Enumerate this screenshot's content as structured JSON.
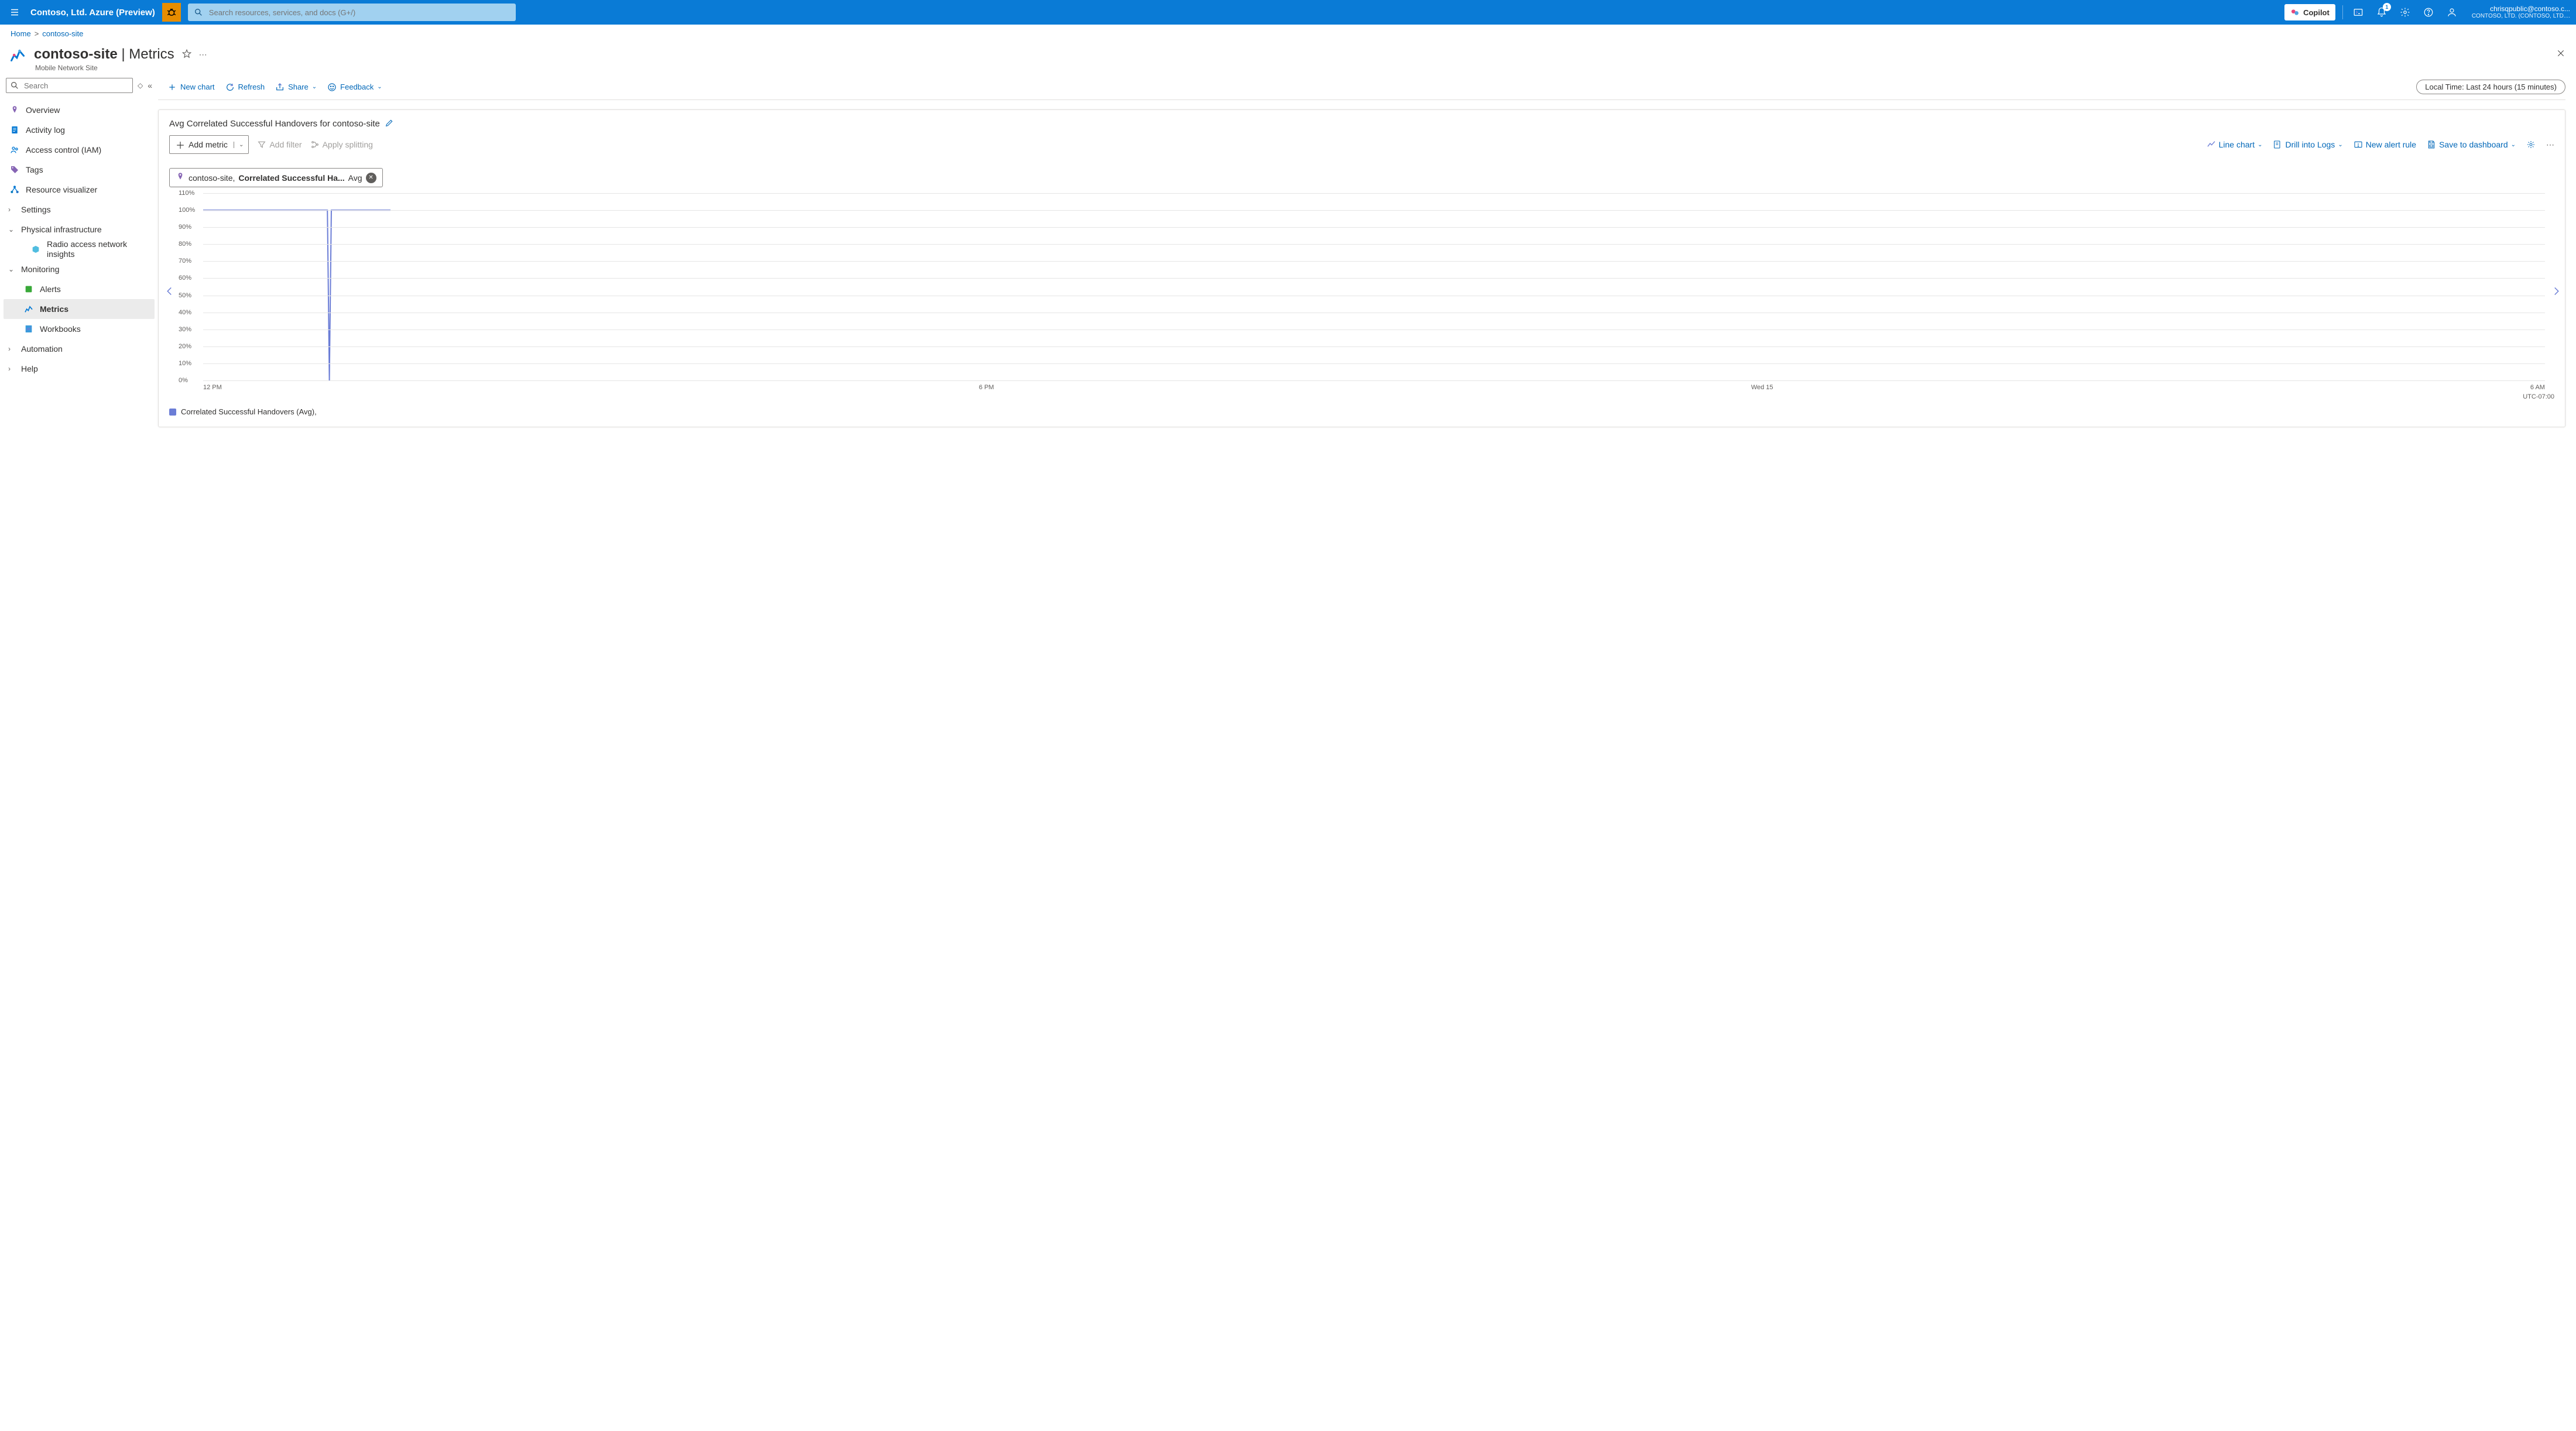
{
  "header": {
    "tenant_title": "Contoso, Ltd. Azure (Preview)",
    "search_placeholder": "Search resources, services, and docs (G+/)",
    "copilot_label": "Copilot",
    "notification_badge": "1",
    "account_email": "chrisqpublic@contoso.c...",
    "account_tenant": "CONTOSO, LTD. (CONTOSO, LTD...."
  },
  "breadcrumbs": {
    "home": "Home",
    "current": "contoso-site"
  },
  "page": {
    "resource_name": "contoso-site",
    "blade_title": "Metrics",
    "subtitle": "Mobile Network Site"
  },
  "sidebar": {
    "search_placeholder": "Search",
    "items": {
      "overview": "Overview",
      "activity": "Activity log",
      "iam": "Access control (IAM)",
      "tags": "Tags",
      "resviz": "Resource visualizer",
      "settings": "Settings",
      "phys_infra": "Physical infrastructure",
      "ran": "Radio access network insights",
      "monitoring": "Monitoring",
      "alerts": "Alerts",
      "metrics": "Metrics",
      "workbooks": "Workbooks",
      "automation": "Automation",
      "help": "Help"
    }
  },
  "commands": {
    "new_chart": "New chart",
    "refresh": "Refresh",
    "share": "Share",
    "feedback": "Feedback",
    "time_range": "Local Time: Last 24 hours (15 minutes)"
  },
  "chart": {
    "title": "Avg Correlated Successful Handovers for contoso-site",
    "add_metric": "Add metric",
    "add_filter": "Add filter",
    "apply_splitting": "Apply splitting",
    "line_chart": "Line chart",
    "drill_logs": "Drill into Logs",
    "new_alert": "New alert rule",
    "save_dash": "Save to dashboard",
    "metric_scope": "contoso-site,",
    "metric_name": "Correlated Successful Ha...",
    "metric_agg": "Avg",
    "legend_label": "Correlated Successful Handovers (Avg),",
    "tz_label": "UTC-07:00"
  },
  "chart_data": {
    "type": "line",
    "title": "Avg Correlated Successful Handovers for contoso-site",
    "xlabel": "",
    "ylabel": "",
    "ylim": [
      0,
      110
    ],
    "y_ticks": [
      110,
      100,
      90,
      80,
      70,
      60,
      50,
      40,
      30,
      20,
      10,
      0
    ],
    "y_tick_labels": [
      "110%",
      "100%",
      "90%",
      "80%",
      "70%",
      "60%",
      "50%",
      "40%",
      "30%",
      "20%",
      "10%",
      "0%"
    ],
    "x_tick_labels": [
      "12 PM",
      "6 PM",
      "Wed 15",
      "6 AM"
    ],
    "series": [
      {
        "name": "Correlated Successful Handovers (Avg)",
        "x": [
          0,
          1,
          2,
          3,
          4,
          5,
          6,
          7,
          8,
          9,
          10,
          11,
          12,
          13,
          14,
          15,
          16,
          17,
          18,
          19,
          20,
          21,
          22,
          23,
          24,
          25,
          26,
          27,
          28,
          29,
          30,
          31,
          32,
          33,
          34,
          35,
          36,
          37,
          38,
          39,
          40,
          41,
          42,
          43,
          44,
          45,
          46,
          47,
          48,
          49,
          50,
          51,
          52,
          53,
          54,
          55,
          56,
          57,
          58,
          59,
          60,
          61,
          62,
          63,
          64,
          65,
          66,
          67,
          68,
          69,
          70,
          71,
          72,
          73,
          74,
          75,
          76,
          77,
          78,
          79,
          80,
          81,
          82,
          83,
          84,
          85,
          86,
          87,
          88,
          89,
          90,
          91,
          92,
          93,
          94,
          95
        ],
        "y": [
          100,
          100,
          100,
          100,
          100,
          100,
          100,
          100,
          100,
          100,
          100,
          100,
          100,
          100,
          100,
          100,
          100,
          100,
          100,
          100,
          100,
          100,
          100,
          100,
          100,
          100,
          100,
          100,
          100,
          100,
          100,
          100,
          100,
          100,
          100,
          100,
          100,
          100,
          100,
          100,
          100,
          100,
          100,
          100,
          100,
          100,
          100,
          100,
          100,
          100,
          100,
          100,
          100,
          100,
          100,
          100,
          100,
          100,
          100,
          100,
          100,
          100,
          100,
          100,
          0,
          100,
          100,
          100,
          100,
          100,
          100,
          100,
          100,
          100,
          100,
          100,
          100,
          100,
          100,
          100,
          100,
          100,
          100,
          100,
          100,
          100,
          100,
          100,
          100,
          100,
          100,
          100,
          100,
          100,
          100,
          100
        ]
      }
    ]
  }
}
